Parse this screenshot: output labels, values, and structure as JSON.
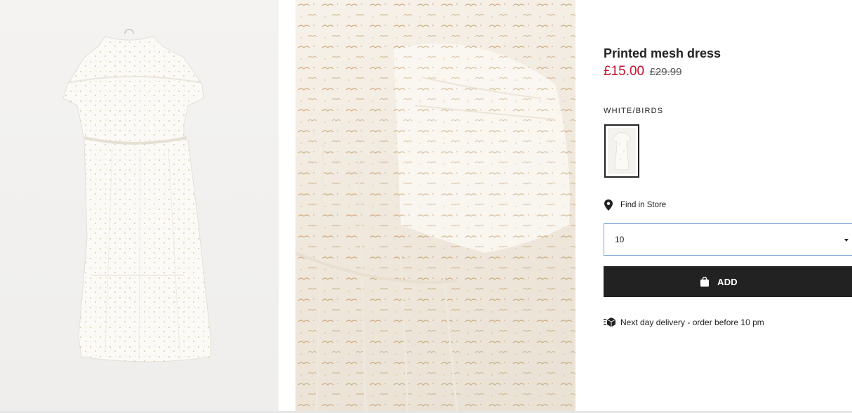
{
  "product": {
    "title": "Printed mesh dress",
    "price": "£15.00",
    "original_price": "£29.99",
    "color_label": "WHITE/BIRDS"
  },
  "store": {
    "find_label": "Find in Store",
    "icon": "location-pin-icon"
  },
  "size": {
    "selected": "10"
  },
  "add_button": {
    "label": "ADD",
    "icon": "shopping-bag-icon"
  },
  "delivery": {
    "text": "Next day delivery - order before 10 pm",
    "icon": "delivery-truck-icon"
  },
  "colors": {
    "sale": "#c8102e",
    "button": "#222222",
    "select_border": "#7aa1d4"
  }
}
